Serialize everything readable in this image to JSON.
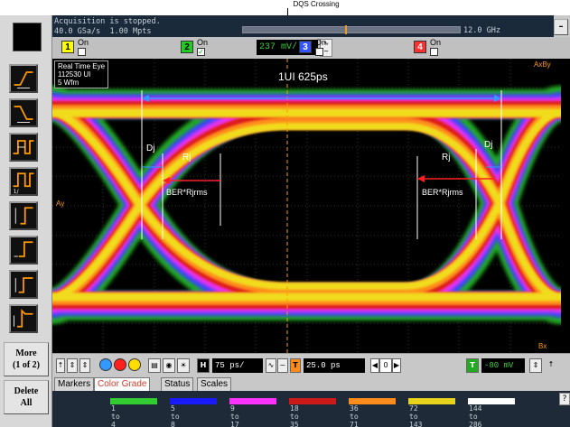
{
  "callout": "DQS Crossing",
  "acquisition": {
    "status": "Acquisition is stopped.",
    "rate": "40.0 GSa/s",
    "points": "1.00 Mpts",
    "bandwidth": "12.0 GHz",
    "minimize": "–"
  },
  "channels": [
    {
      "num": "1",
      "state": "On",
      "checked": false,
      "color": "#ffff00"
    },
    {
      "num": "2",
      "state": "On",
      "checked": true,
      "color": "#22cc22",
      "scale": "237 mV/"
    },
    {
      "num": "3",
      "state": "On",
      "checked": false,
      "color": "#3355ff"
    },
    {
      "num": "4",
      "state": "On",
      "checked": false,
      "color": "#ff3030"
    }
  ],
  "display": {
    "info": [
      "Real Time Eye",
      "112530 UI",
      "5 Wfm"
    ],
    "ui_label": "1UI 625ps",
    "dj_left": "Dj",
    "rj_left": "Rj",
    "dj_right": "Dj",
    "rj_right": "Rj",
    "ber_left": "BER*Rjrms",
    "ber_right": "BER*Rjrms",
    "ay": "Ay",
    "axby": "AxBy",
    "bx": "Bx"
  },
  "controls": {
    "h_label": "H",
    "time_scale": "75 ps/",
    "t_label": "T",
    "delay": "25.0 ps",
    "nav_value": "0",
    "trigger_label": "T",
    "trigger_level": "-80 mV",
    "circle_colors": [
      "#3399ff",
      "#ff2020",
      "#ffdd00"
    ]
  },
  "toolbar": {
    "more": "More",
    "more_sub": "(1 of 2)",
    "delete": "Delete",
    "delete_sub": "All"
  },
  "tabs": [
    "Markers",
    "Color Grade",
    "Status",
    "Scales"
  ],
  "active_tab": "Color Grade",
  "legend": [
    {
      "color": "#33cc33",
      "from": "1",
      "to": "to",
      "end": "4"
    },
    {
      "color": "#1a1aff",
      "from": "5",
      "to": "to",
      "end": "8"
    },
    {
      "color": "#ff33ff",
      "from": "9",
      "to": "to",
      "end": "17"
    },
    {
      "color": "#cc1a1a",
      "from": "18",
      "to": "to",
      "end": "35"
    },
    {
      "color": "#ff8c1a",
      "from": "36",
      "to": "to",
      "end": "71"
    },
    {
      "color": "#e6d21a",
      "from": "72",
      "to": "to",
      "end": "143"
    },
    {
      "color": "#ffffff",
      "from": "144",
      "to": "to",
      "end": "286"
    }
  ],
  "help": "?"
}
